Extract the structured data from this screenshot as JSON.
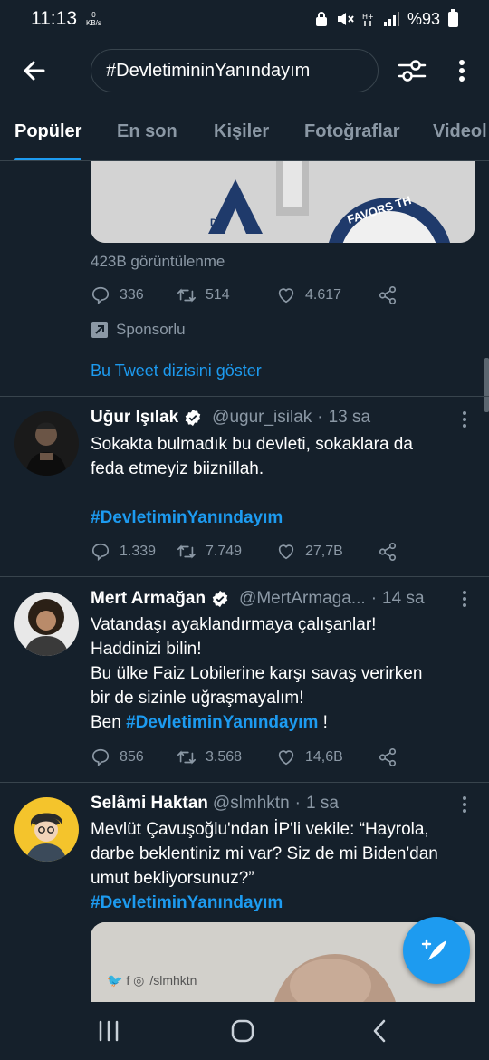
{
  "status_bar": {
    "time": "11:13",
    "net_speed_value": "0",
    "net_speed_unit": "KB/s",
    "battery": "%93"
  },
  "search": {
    "query": "#DevletimininYanındayım"
  },
  "tabs": [
    {
      "label": "Popüler",
      "active": true
    },
    {
      "label": "En son",
      "active": false
    },
    {
      "label": "Kişiler",
      "active": false
    },
    {
      "label": "Fotoğraflar",
      "active": false
    },
    {
      "label": "Videol",
      "active": false
    }
  ],
  "sponsored_tweet": {
    "media_logo_text": "D H",
    "media_badge_text": "FAVORS TH",
    "views": "423B görüntülenme",
    "replies": "336",
    "retweets": "514",
    "likes": "4.617",
    "sponsor_label": "Sponsorlu",
    "show_thread": "Bu Tweet dizisini göster"
  },
  "tweets": [
    {
      "name": "Uğur Işılak",
      "handle": "@ugur_isilak",
      "time": "13 sa",
      "text_lines": [
        "Sokakta bulmadık bu devleti, sokaklara da",
        "feda etmeyiz biiznillah."
      ],
      "hashtag": "#DevletiminYanındayım",
      "replies": "1.339",
      "retweets": "7.749",
      "likes": "27,7B"
    },
    {
      "name": "Mert Armağan",
      "handle": "@MertArmaga...",
      "time": "14 sa",
      "text_lines": [
        "Vatandaşı ayaklandırmaya çalışanlar!",
        "Haddinizi bilin!",
        "Bu ülke Faiz Lobilerine karşı savaş verirken",
        "bir de sizinle uğraşmayalım!"
      ],
      "last_prefix": "Ben ",
      "hashtag": "#DevletiminYanındayım",
      "last_suffix": " !",
      "replies": "856",
      "retweets": "3.568",
      "likes": "14,6B"
    },
    {
      "name": "Selâmi Haktan",
      "handle": "@slmhktn",
      "time": "1 sa",
      "text_lines": [
        "Mevlüt Çavuşoğlu'ndan İP'li vekile: “Hayrola,",
        "darbe beklentiniz mi var? Siz de mi Biden'dan",
        "umut bekliyorsunuz?”"
      ],
      "hashtag": "#DevletiminYanındayım",
      "media_watermark": "/slmhktn"
    }
  ],
  "colors": {
    "background": "#15202b",
    "accent": "#1d9bf0",
    "secondary_text": "#8b98a5",
    "divider": "#38444d"
  }
}
